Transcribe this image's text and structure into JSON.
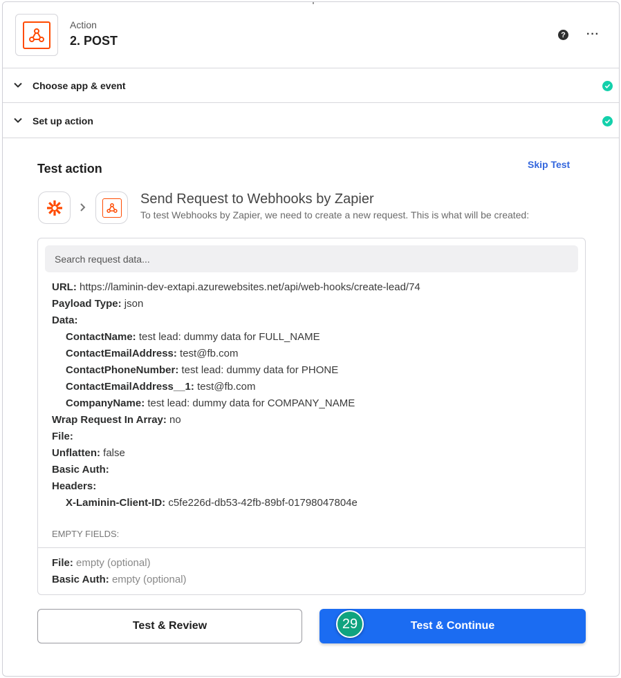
{
  "header": {
    "subtitle": "Action",
    "title": "2. POST",
    "help_icon": "question-circle-icon",
    "more_icon": "ellipsis-icon",
    "more_label": "···",
    "help_label": "?"
  },
  "accordion": [
    {
      "label": "Choose app & event",
      "status": "complete"
    },
    {
      "label": "Set up action",
      "status": "complete"
    }
  ],
  "test_action": {
    "title": "Test action",
    "skip_label": "Skip Test",
    "request_title": "Send Request to Webhooks by Zapier",
    "request_subtitle": "To test Webhooks by Zapier, we need to create a new request. This is what will be created:",
    "search_placeholder": "Search request data...",
    "fields": [
      {
        "key": "URL:",
        "value": "https://laminin-dev-extapi.azurewebsites.net/api/web-hooks/create-lead/74",
        "indent": false
      },
      {
        "key": "Payload Type:",
        "value": "json",
        "indent": false
      },
      {
        "key": "Data:",
        "value": "",
        "indent": false
      },
      {
        "key": "ContactName:",
        "value": "test lead: dummy data for FULL_NAME",
        "indent": true
      },
      {
        "key": "ContactEmailAddress:",
        "value": "test@fb.com",
        "indent": true
      },
      {
        "key": "ContactPhoneNumber:",
        "value": "test lead: dummy data for PHONE",
        "indent": true
      },
      {
        "key": "ContactEmailAddress__1:",
        "value": "test@fb.com",
        "indent": true
      },
      {
        "key": "CompanyName:",
        "value": "test lead: dummy data for COMPANY_NAME",
        "indent": true
      },
      {
        "key": "Wrap Request In Array:",
        "value": "no",
        "indent": false
      },
      {
        "key": "File:",
        "value": "",
        "indent": false
      },
      {
        "key": "Unflatten:",
        "value": "false",
        "indent": false
      },
      {
        "key": "Basic Auth:",
        "value": "",
        "indent": false
      },
      {
        "key": "Headers:",
        "value": "",
        "indent": false
      },
      {
        "key": "X-Laminin-Client-ID:",
        "value": "c5fe226d-db53-42fb-89bf-01798047804e",
        "indent": true
      }
    ],
    "empty_fields_title": "EMPTY FIELDS:",
    "empty_fields": [
      {
        "key": "File:",
        "value": "empty (optional)"
      },
      {
        "key": "Basic Auth:",
        "value": "empty (optional)"
      }
    ]
  },
  "buttons": {
    "review_label": "Test & Review",
    "continue_label": "Test & Continue"
  },
  "badge": {
    "value": "29"
  },
  "colors": {
    "accent": "#1b6cf2",
    "brand": "#ff4a00",
    "success": "#13d0ab",
    "badge": "#10a37f",
    "link": "#3366dd"
  }
}
